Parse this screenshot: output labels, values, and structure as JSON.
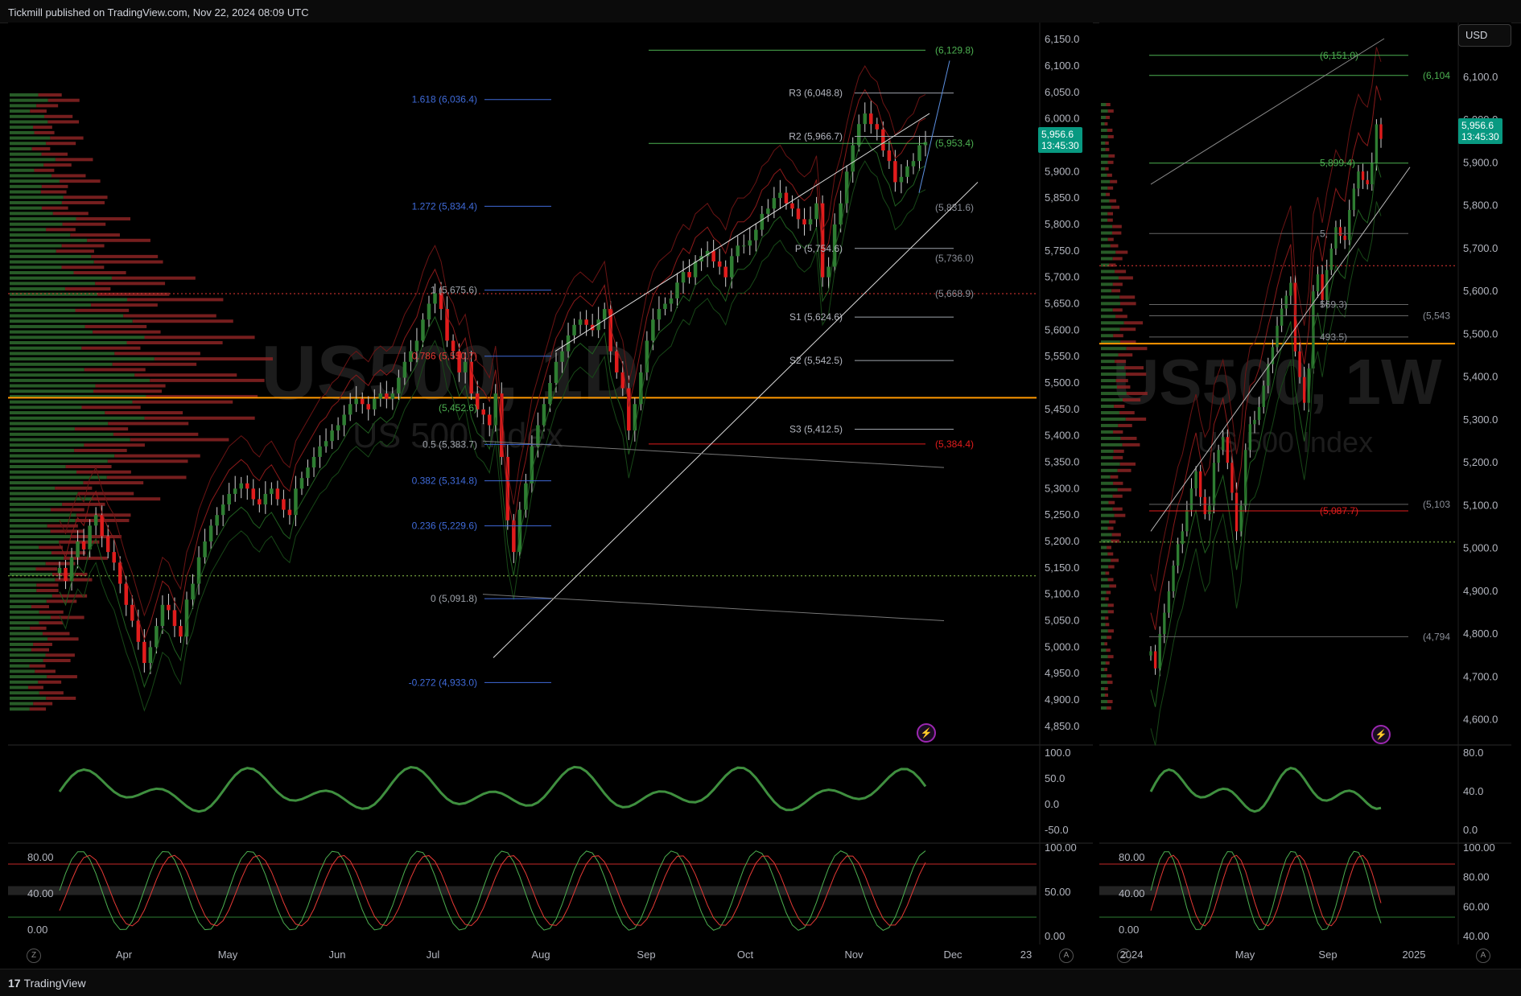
{
  "header": {
    "published": "Tickmill published on TradingView.com, Nov 22, 2024 08:09 UTC"
  },
  "footer": {
    "brand": "TradingView",
    "brand_mark": "17"
  },
  "currency_button": "USD",
  "colors": {
    "up": "#2e7d32",
    "down": "#e01c1c",
    "fib": "#3f6ad8",
    "pivot_green": "#4caf50",
    "orange_line": "#ff9800",
    "red_dotted": "#e53935",
    "green_dotted": "#8bc34a"
  },
  "chart_data": [
    {
      "type": "candlestick",
      "symbol_watermark": "US500, 1D",
      "watermark_sub": "US 500 Index",
      "x_ticks": [
        "Apr",
        "May",
        "Jun",
        "Jul",
        "Aug",
        "Sep",
        "Oct",
        "Nov",
        "Dec",
        "23"
      ],
      "y_ticks": [
        "6,150.0",
        "6,100.0",
        "6,050.0",
        "6,000.0",
        "5,950.0",
        "5,900.0",
        "5,850.0",
        "5,800.0",
        "5,750.0",
        "5,700.0",
        "5,650.0",
        "5,600.0",
        "5,550.0",
        "5,500.0",
        "5,450.0",
        "5,400.0",
        "5,350.0",
        "5,300.0",
        "5,250.0",
        "5,200.0",
        "5,150.0",
        "5,100.0",
        "5,050.0",
        "5,000.0",
        "4,950.0",
        "4,900.0",
        "4,850.0"
      ],
      "ylim": [
        4830,
        6170
      ],
      "last_price": "5,956.6",
      "countdown": "13:45:30",
      "fib_levels": [
        {
          "label": "1.618 (6,036.4)",
          "value": 6036.4
        },
        {
          "label": "1.272 (5,834.4)",
          "value": 5834.4
        },
        {
          "label": "1 (5,675.6)",
          "value": 5675.6
        },
        {
          "label": "0.786 (5,550.7)",
          "value": 5550.7
        },
        {
          "label": "0.5 (5,383.7)",
          "value": 5383.7
        },
        {
          "label": "0.382 (5,314.8)",
          "value": 5314.8
        },
        {
          "label": "0.236 (5,229.6)",
          "value": 5229.6
        },
        {
          "label": "0 (5,091.8)",
          "value": 5091.8
        },
        {
          "label": "-0.272 (4,933.0)",
          "value": 4933.0
        }
      ],
      "fib_extra": {
        "label": "(5,452.6)",
        "value": 5452.6
      },
      "pivots": [
        {
          "label": "R3 (6,048.8)",
          "value": 6048.8
        },
        {
          "label": "R2 (5,966.7)",
          "value": 5966.7
        },
        {
          "label": "P (5,754.6)",
          "value": 5754.6
        },
        {
          "label": "S1 (5,624.6)",
          "value": 5624.6
        },
        {
          "label": "S2 (5,542.5)",
          "value": 5542.5
        },
        {
          "label": "S3 (5,412.5)",
          "value": 5412.5
        }
      ],
      "right_labels": [
        {
          "label": "(6,129.8)",
          "value": 6129.8,
          "color": "green"
        },
        {
          "label": "(5,953.4)",
          "value": 5953.4,
          "color": "green"
        },
        {
          "label": "(5,831.6)",
          "value": 5831.6,
          "color": "gray"
        },
        {
          "label": "(5,736.0)",
          "value": 5736.0,
          "color": "gray"
        },
        {
          "label": "(5,668.9)",
          "value": 5668.9,
          "color": "gray"
        },
        {
          "label": "(5,384.4)",
          "value": 5384.4,
          "color": "red"
        }
      ],
      "orange_level": 5472,
      "red_dotted_level": 5669,
      "green_dotted_level": 5135,
      "closes": [
        5150,
        5125,
        5170,
        5200,
        5185,
        5230,
        5250,
        5210,
        5180,
        5160,
        5120,
        5080,
        5050,
        5010,
        4970,
        5000,
        5040,
        5080,
        5070,
        5040,
        5020,
        5090,
        5120,
        5170,
        5200,
        5230,
        5250,
        5270,
        5290,
        5300,
        5310,
        5300,
        5280,
        5270,
        5290,
        5300,
        5280,
        5260,
        5250,
        5300,
        5320,
        5340,
        5360,
        5380,
        5390,
        5410,
        5420,
        5440,
        5460,
        5470,
        5460,
        5450,
        5470,
        5480,
        5470,
        5480,
        5510,
        5540,
        5560,
        5580,
        5620,
        5650,
        5670,
        5640,
        5580,
        5560,
        5520,
        5540,
        5480,
        5450,
        5440,
        5420,
        5480,
        5360,
        5240,
        5180,
        5260,
        5310,
        5380,
        5420,
        5460,
        5500,
        5540,
        5560,
        5590,
        5610,
        5620,
        5610,
        5600,
        5620,
        5640,
        5560,
        5520,
        5490,
        5410,
        5460,
        5520,
        5580,
        5620,
        5640,
        5650,
        5660,
        5690,
        5710,
        5700,
        5730,
        5740,
        5750,
        5730,
        5720,
        5700,
        5740,
        5760,
        5760,
        5770,
        5790,
        5820,
        5830,
        5850,
        5860,
        5840,
        5830,
        5810,
        5800,
        5810,
        5840,
        5700,
        5720,
        5800,
        5840,
        5900,
        5950,
        5990,
        6010,
        5990,
        5980,
        5940,
        5920,
        5880,
        5890,
        5910,
        5920,
        5950,
        5956
      ],
      "oscillator1": {
        "ticks": [
          "100.0",
          "50.0",
          "0.0",
          "-50.0"
        ]
      },
      "oscillator2": {
        "ticks": [
          "100.00",
          "50.00",
          "0.00"
        ],
        "left_ticks": [
          "80.00",
          "40.00",
          "0.00"
        ]
      }
    },
    {
      "type": "candlestick",
      "symbol_watermark": "US500, 1W",
      "watermark_sub": "US 500 Index",
      "x_ticks": [
        "2024",
        "May",
        "Sep",
        "2025"
      ],
      "y_ticks": [
        "6,100.0",
        "6,000.0",
        "5,900.0",
        "5,800.0",
        "5,700.0",
        "5,600.0",
        "5,500.0",
        "5,400.0",
        "5,300.0",
        "5,200.0",
        "5,100.0",
        "5,000.0",
        "4,900.0",
        "4,800.0",
        "4,700.0",
        "4,600.0"
      ],
      "ylim": [
        4560,
        6190
      ],
      "last_price": "5,956.6",
      "countdown": "13:45:30",
      "levels": [
        {
          "label": "(6,151.0)",
          "value": 6151.0,
          "color": "green"
        },
        {
          "label": "(6,104",
          "value": 6104,
          "color": "green"
        },
        {
          "label": "5,899.4)",
          "value": 5899.4,
          "color": "green"
        },
        {
          "label": "5,",
          "value": 5735,
          "color": "gray"
        },
        {
          "label": "569.3)",
          "value": 5569.3,
          "color": "gray"
        },
        {
          "label": "(5,543",
          "value": 5543,
          "color": "gray"
        },
        {
          "label": "493.5)",
          "value": 5493.5,
          "color": "gray"
        },
        {
          "label": "(5,103",
          "value": 5103,
          "color": "gray"
        },
        {
          "label": "(5,087.7)",
          "value": 5087.7,
          "color": "red"
        },
        {
          "label": "(4,794",
          "value": 4794,
          "color": "gray"
        }
      ],
      "orange_level": 5478,
      "red_dotted_level": 5660,
      "green_dotted_level": 5015,
      "closes": [
        4760,
        4720,
        4800,
        4850,
        4900,
        4960,
        5010,
        5040,
        5090,
        5140,
        5180,
        5120,
        5080,
        5100,
        5200,
        5230,
        5260,
        5200,
        5130,
        5040,
        5100,
        5230,
        5290,
        5300,
        5330,
        5380,
        5430,
        5470,
        5520,
        5560,
        5590,
        5620,
        5460,
        5400,
        5340,
        5420,
        5600,
        5640,
        5580,
        5650,
        5700,
        5750,
        5730,
        5720,
        5790,
        5840,
        5880,
        5860,
        5850,
        5900,
        5990,
        5956
      ],
      "oscillator1": {
        "ticks": [
          "80.0",
          "40.0",
          "0.0"
        ]
      },
      "oscillator2": {
        "ticks": [
          "100.00",
          "80.00",
          "60.00",
          "40.00"
        ],
        "left_ticks": [
          "80.00",
          "40.00",
          "0.00"
        ]
      }
    }
  ]
}
